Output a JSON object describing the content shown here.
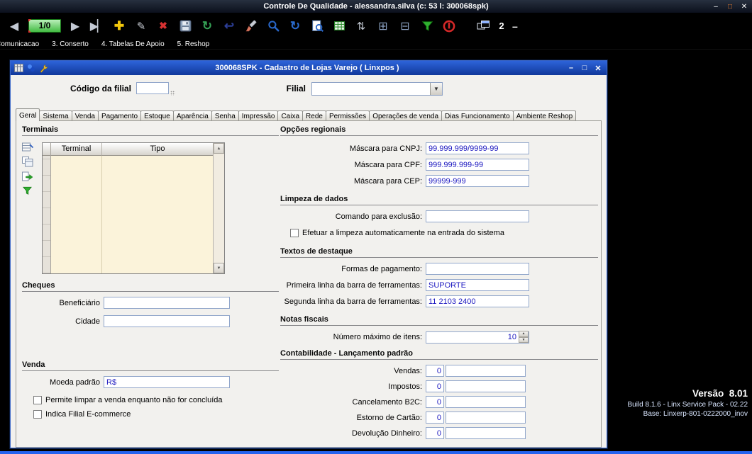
{
  "app": {
    "title": "Controle De Qualidade - alessandra.silva (c: 53 l: 300068spk)"
  },
  "colors": {
    "record_counter_bg": "#43bb43",
    "mdi_titlebar_blue": "#1c4fc4",
    "field_text_blue": "#1c18c0",
    "desktop_bg": "#000000",
    "bottom_strip_blue": "#2463ef"
  },
  "icons": {
    "first_record": "◀",
    "next_record": "▶",
    "last_record": "▶▏",
    "add": "✚",
    "edit": "✎",
    "delete": "✖",
    "refresh": "↻",
    "undo": "↩",
    "sync": "↻",
    "sort": "⇅",
    "add_query": "⊞",
    "remove_query": "⊟",
    "minimize": "–",
    "maximize": "□",
    "close": "✕",
    "combo_arrow": "▼",
    "spin_up": "▲",
    "spin_down": "▼",
    "scroll_up": "▲",
    "scroll_down": "▼",
    "dash": "–"
  },
  "toolbar": {
    "record_counter": "1/0",
    "open_windows_count": "2"
  },
  "menu": {
    "items": [
      "Comunicacao",
      "3. Conserto",
      "4. Tabelas De Apoio",
      "5. Reshop"
    ]
  },
  "mdi": {
    "title": "300068SPK - Cadastro de Lojas Varejo ( Linxpos )",
    "header": {
      "codigo_label": "Código da filial",
      "codigo_value": "",
      "filial_label": "Filial",
      "filial_value": ""
    },
    "tabs": [
      "Geral",
      "Sistema",
      "Venda",
      "Pagamento",
      "Estoque",
      "Aparência",
      "Senha",
      "Impressão",
      "Caixa",
      "Rede",
      "Permissões",
      "Operações de venda",
      "Dias Funcionamento",
      "Ambiente Reshop"
    ],
    "active_tab": "Geral",
    "terminais": {
      "title": "Terminais",
      "columns": [
        "Terminal",
        "Tipo"
      ],
      "rows": []
    },
    "cheques": {
      "title": "Cheques",
      "beneficiario_label": "Beneficiário",
      "beneficiario_value": "",
      "cidade_label": "Cidade",
      "cidade_value": ""
    },
    "venda": {
      "title": "Venda",
      "moeda_label": "Moeda padrão",
      "moeda_value": "R$",
      "check1": "Permite limpar a venda enquanto não for concluída",
      "check2": "Indica Filial E-commerce"
    },
    "opcoes_regionais": {
      "title": "Opções regionais",
      "cnpj_label": "Máscara para CNPJ:",
      "cnpj_value": "99.999.999/9999-99",
      "cpf_label": "Máscara para CPF:",
      "cpf_value": "999.999.999-99",
      "cep_label": "Máscara para CEP:",
      "cep_value": "99999-999"
    },
    "limpeza": {
      "title": "Limpeza de dados",
      "comando_label": "Comando para exclusão:",
      "comando_value": "",
      "check": "Efetuar a limpeza automaticamente na entrada do sistema"
    },
    "textos": {
      "title": "Textos de destaque",
      "formas_label": "Formas de pagamento:",
      "formas_value": "",
      "linha1_label": "Primeira linha da barra de ferramentas:",
      "linha1_value": "SUPORTE",
      "linha2_label": "Segunda linha da barra de ferramentas:",
      "linha2_value": "11 2103 2400"
    },
    "notas": {
      "title": "Notas fiscais",
      "max_itens_label": "Número máximo de itens:",
      "max_itens_value": "10"
    },
    "contabilidade": {
      "title": "Contabilidade - Lançamento padrão",
      "rows": [
        {
          "label": "Vendas:",
          "code": "0",
          "desc": ""
        },
        {
          "label": "Impostos:",
          "code": "0",
          "desc": ""
        },
        {
          "label": "Cancelamento B2C:",
          "code": "0",
          "desc": ""
        },
        {
          "label": "Estorno de Cartão:",
          "code": "0",
          "desc": ""
        },
        {
          "label": "Devolução Dinheiro:",
          "code": "0",
          "desc": ""
        }
      ]
    }
  },
  "version": {
    "line1": "Versão  8.01",
    "line2": "Build 8.1.6 - Linx Service Pack - 02.22",
    "line3": "Base: Linxerp-801-0222000_inov"
  }
}
